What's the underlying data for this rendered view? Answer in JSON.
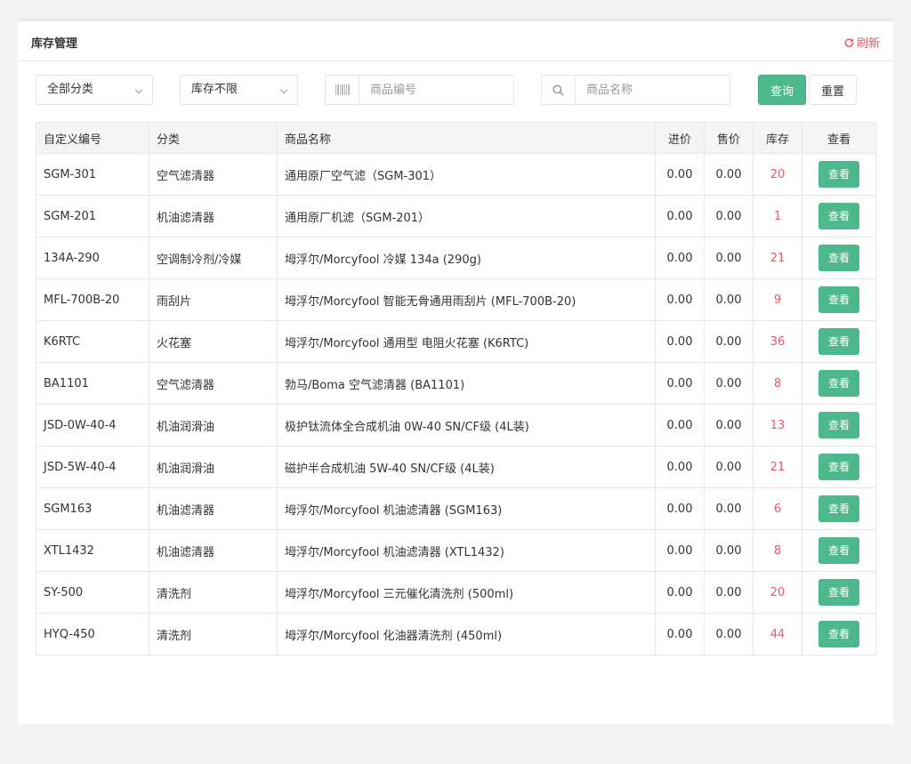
{
  "panel": {
    "title": "库存管理",
    "refresh_label": "刷新",
    "accent_color": "#ed5565",
    "primary_color": "#4cb88c"
  },
  "filters": {
    "category": "全部分类",
    "stock": "库存不限",
    "code_placeholder": "商品编号",
    "name_placeholder": "商品名称",
    "search_label": "查询",
    "reset_label": "重置"
  },
  "table": {
    "headers": [
      "自定义编号",
      "分类",
      "商品名称",
      "进价",
      "售价",
      "库存",
      "查看"
    ],
    "view_label": "查看",
    "rows": [
      {
        "code": "SGM-301",
        "category": "空气滤清器",
        "name": "通用原厂空气滤（SGM-301）",
        "cost": "0.00",
        "price": "0.00",
        "stock": "20"
      },
      {
        "code": "SGM-201",
        "category": "机油滤清器",
        "name": "通用原厂机滤（SGM-201）",
        "cost": "0.00",
        "price": "0.00",
        "stock": "1"
      },
      {
        "code": "134A-290",
        "category": "空调制冷剂/冷媒",
        "name": "坶浮尔/Morcyfool 冷媒 134a (290g)",
        "cost": "0.00",
        "price": "0.00",
        "stock": "21"
      },
      {
        "code": "MFL-700B-20",
        "category": "雨刮片",
        "name": "坶浮尔/Morcyfool 智能无骨通用雨刮片 (MFL-700B-20)",
        "cost": "0.00",
        "price": "0.00",
        "stock": "9"
      },
      {
        "code": "K6RTC",
        "category": "火花塞",
        "name": "坶浮尔/Morcyfool 通用型 电阻火花塞 (K6RTC)",
        "cost": "0.00",
        "price": "0.00",
        "stock": "36"
      },
      {
        "code": "BA1101",
        "category": "空气滤清器",
        "name": "勃马/Boma 空气滤清器 (BA1101)",
        "cost": "0.00",
        "price": "0.00",
        "stock": "8"
      },
      {
        "code": "JSD-0W-40-4",
        "category": "机油润滑油",
        "name": "极护钛流体全合成机油 0W-40 SN/CF级 (4L装)",
        "cost": "0.00",
        "price": "0.00",
        "stock": "13"
      },
      {
        "code": "JSD-5W-40-4",
        "category": "机油润滑油",
        "name": "磁护半合成机油 5W-40 SN/CF级 (4L装)",
        "cost": "0.00",
        "price": "0.00",
        "stock": "21"
      },
      {
        "code": "SGM163",
        "category": "机油滤清器",
        "name": "坶浮尔/Morcyfool 机油滤清器 (SGM163)",
        "cost": "0.00",
        "price": "0.00",
        "stock": "6"
      },
      {
        "code": "XTL1432",
        "category": "机油滤清器",
        "name": "坶浮尔/Morcyfool 机油滤清器 (XTL1432)",
        "cost": "0.00",
        "price": "0.00",
        "stock": "8"
      },
      {
        "code": "SY-500",
        "category": "清洗剂",
        "name": "坶浮尔/Morcyfool 三元催化清洗剂 (500ml)",
        "cost": "0.00",
        "price": "0.00",
        "stock": "20"
      },
      {
        "code": "HYQ-450",
        "category": "清洗剂",
        "name": "坶浮尔/Morcyfool 化油器清洗剂 (450ml)",
        "cost": "0.00",
        "price": "0.00",
        "stock": "44"
      }
    ]
  }
}
